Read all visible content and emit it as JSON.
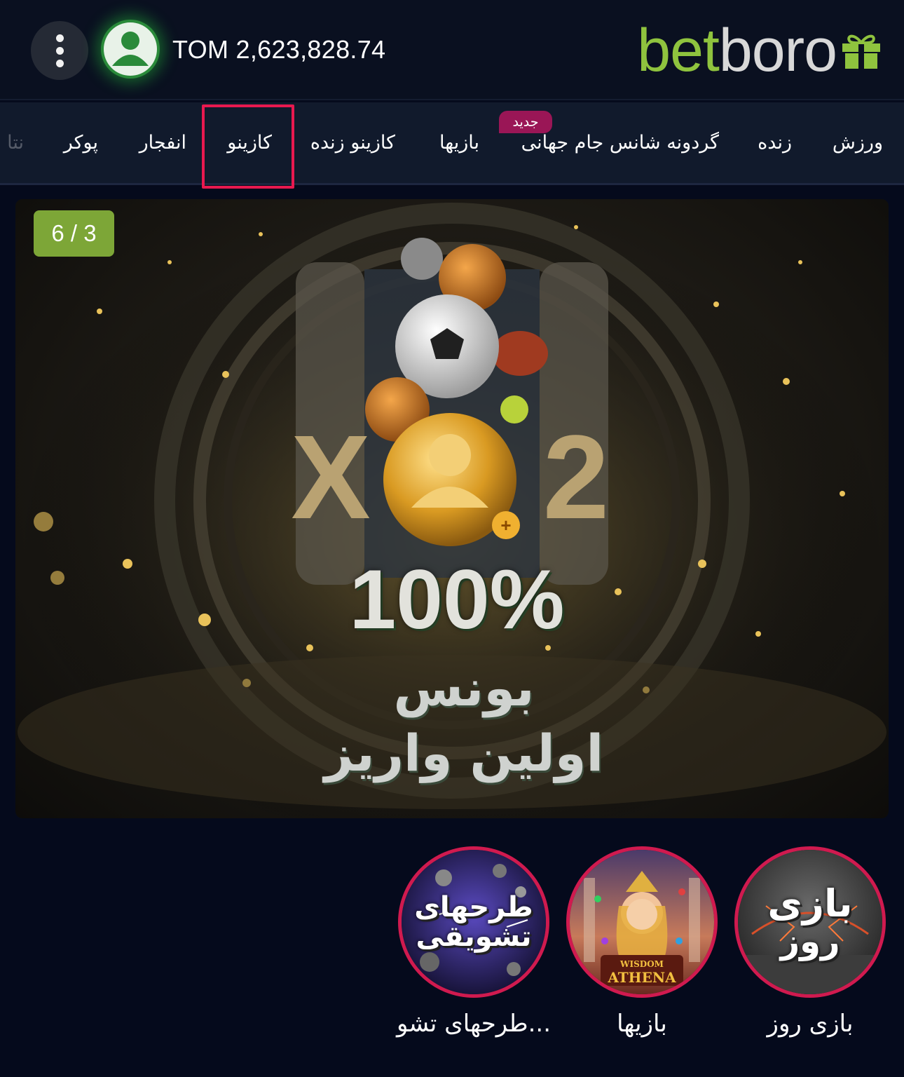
{
  "header": {
    "balance": "TOM 2,623,828.74",
    "logo": {
      "part1": "bet",
      "part2": "boro",
      "icon": "gift-icon"
    },
    "menu_icon": "kebab-menu-icon",
    "avatar_icon": "user-avatar-icon"
  },
  "nav": {
    "items": [
      {
        "label": "ورزش"
      },
      {
        "label": "زنده"
      },
      {
        "label": "گردونه شانس جام جهانی",
        "badge": "جدید"
      },
      {
        "label": "بازیها"
      },
      {
        "label": "کازینو زنده"
      },
      {
        "label": "کازینو",
        "highlighted": true
      },
      {
        "label": "انفجار"
      },
      {
        "label": "پوکر"
      },
      {
        "label": "نتا"
      }
    ]
  },
  "banner": {
    "slide_counter": "6 / 3",
    "multiplier_left": "X",
    "multiplier_right": "2",
    "percent": "100%",
    "line1": "بونس",
    "line2": "اولین واریز"
  },
  "stories": [
    {
      "label": "بازی روز",
      "art_text_top": "بازی",
      "art_text_bottom": "روز"
    },
    {
      "label": "بازیها",
      "art_text_top": "WISDOM",
      "art_text_bottom": "ATHENA"
    },
    {
      "label": "طرحهای تشو...",
      "art_text_top": "طرحهای",
      "art_text_bottom": "تشویقی"
    }
  ],
  "colors": {
    "accent_green": "#8fc33e",
    "highlight_pink": "#e8194f",
    "badge_magenta": "#9a1656",
    "story_ring": "#d01a4f",
    "background": "#050a1c"
  }
}
